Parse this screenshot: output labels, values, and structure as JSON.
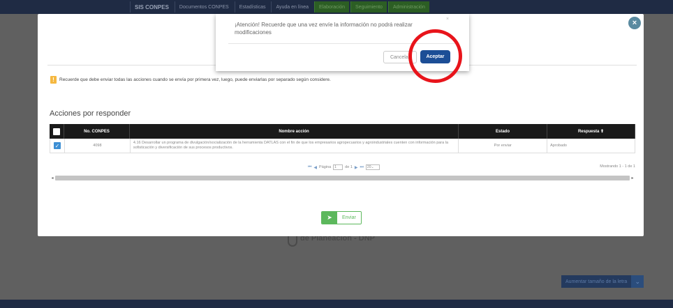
{
  "nav": {
    "logo": "SIS CONPES",
    "items": [
      "Documentos CONPES",
      "Estadísticas",
      "Ayuda en línea"
    ],
    "green_items": [
      "Elaboración",
      "Seguimiento",
      "Administración"
    ]
  },
  "background": {
    "footer_text": "de Planeación - DNP",
    "font_size_button": "Aumentar tamaño de la letra",
    "font_size_icon": "chevron-down-icon"
  },
  "modal": {
    "close_icon": "×",
    "notice_icon": "!",
    "notice_text": "Recuerde que debe enviar todas las acciones cuando se envía por primera vez, luego, puede enviarlas por separado según considere.",
    "section_title": "Acciones por responder",
    "table": {
      "headers": {
        "conpes": "No. CONPES",
        "accion": "Nombre acción",
        "estado": "Estado",
        "respuesta": "Respuesta ⬆"
      },
      "rows": [
        {
          "checked": "✓",
          "conpes": "4098",
          "accion": "4.16 Desarrollar un programa de divulgación/socialización de la herramienta DATLAS con el fin de que los empresarios agropecuarios y agroindustriales cuenten con información para la sofisticación y diversificación de sus procesos productivos.",
          "estado": "Por enviar",
          "respuesta": "Aprobado"
        }
      ]
    },
    "pager": {
      "first": "⏮",
      "prev": "◀",
      "page_label": "Página",
      "page_value": "1",
      "of_label": "de 1",
      "next": "▶",
      "last": "⏭",
      "page_size": "20",
      "summary": "Mostrando 1 - 1 de 1"
    },
    "send_button": {
      "icon": "➤",
      "label": "Enviar"
    }
  },
  "dialog": {
    "message": "¡Atención! Recuerde que una vez envíe la información no podrá realizar modificaciones",
    "close": "×",
    "cancel_label": "Cancelar",
    "accept_label": "Aceptar"
  },
  "colors": {
    "accept": "#1c4e96",
    "highlight": "#e8141b",
    "send": "#5cb85c",
    "check": "#3d8fd4"
  }
}
